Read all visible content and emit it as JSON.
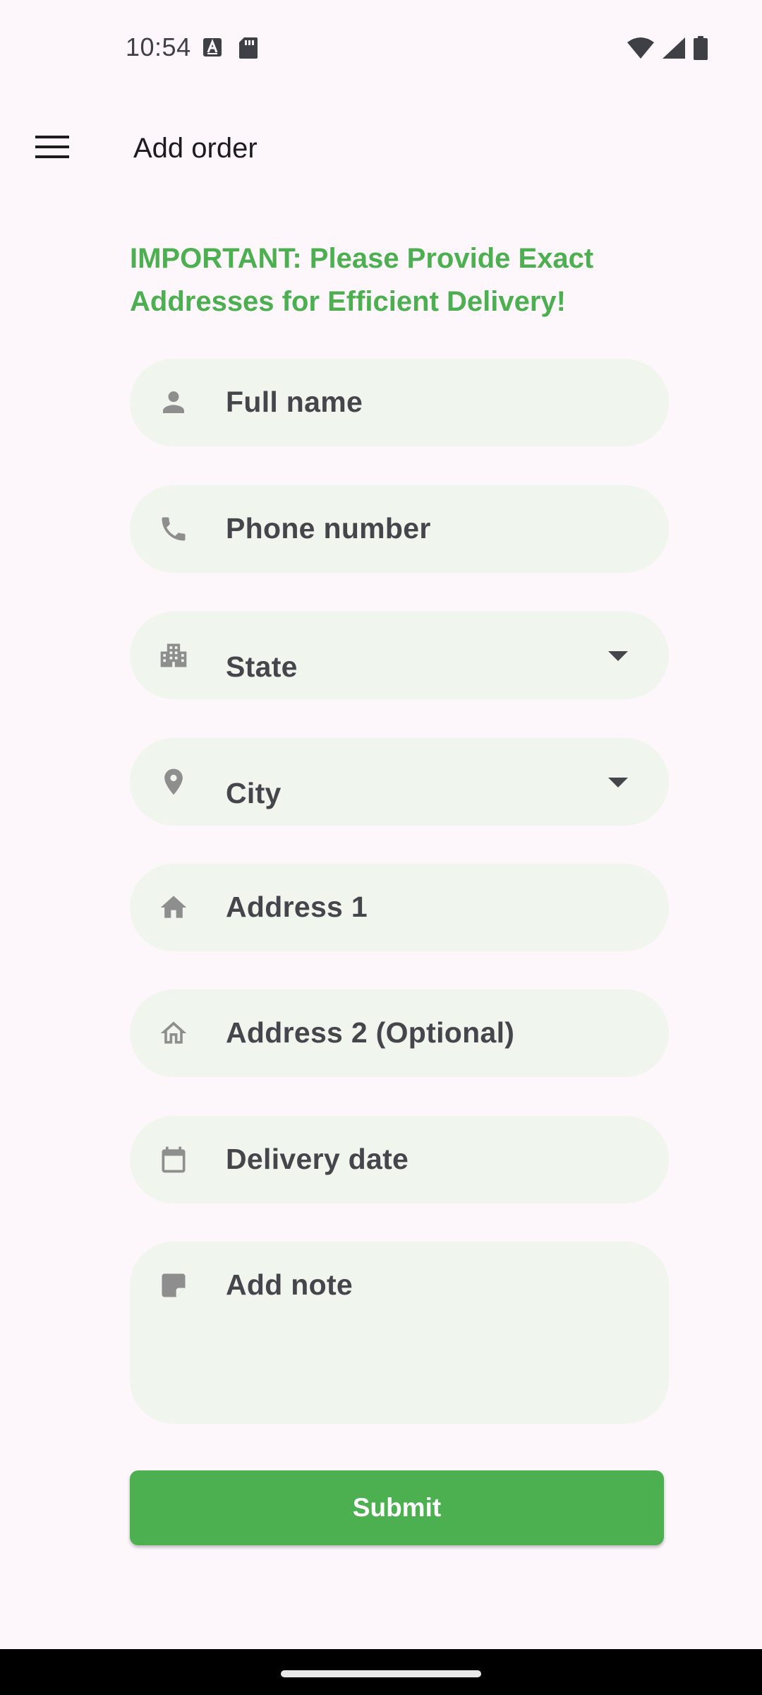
{
  "status_bar": {
    "time": "10:54",
    "left_icons": [
      "text-a-notification-icon",
      "sd-card-icon"
    ],
    "right_icons": [
      "wifi-icon",
      "cell-signal-icon",
      "battery-icon"
    ]
  },
  "app_bar": {
    "title": "Add order",
    "menu_icon": "hamburger-menu-icon"
  },
  "notice": "IMPORTANT: Please Provide Exact Addresses for Efficient Delivery!",
  "form": {
    "full_name": {
      "label": "Full name",
      "icon": "person-icon"
    },
    "phone": {
      "label": "Phone number",
      "icon": "phone-icon"
    },
    "state": {
      "label": "State",
      "icon": "building-icon"
    },
    "city": {
      "label": "City",
      "icon": "location-pin-icon"
    },
    "address1": {
      "label": "Address 1",
      "icon": "home-filled-icon"
    },
    "address2": {
      "label": "Address 2 (Optional)",
      "icon": "home-outline-icon"
    },
    "delivery_date": {
      "label": "Delivery date",
      "icon": "calendar-icon"
    },
    "note": {
      "label": "Add note",
      "icon": "sticky-note-icon"
    }
  },
  "submit_label": "Submit",
  "colors": {
    "accent": "#4caf50",
    "background": "#fdf7fc",
    "field_fill": "#f0f5ee",
    "icon_gray": "#8e8e8e"
  }
}
